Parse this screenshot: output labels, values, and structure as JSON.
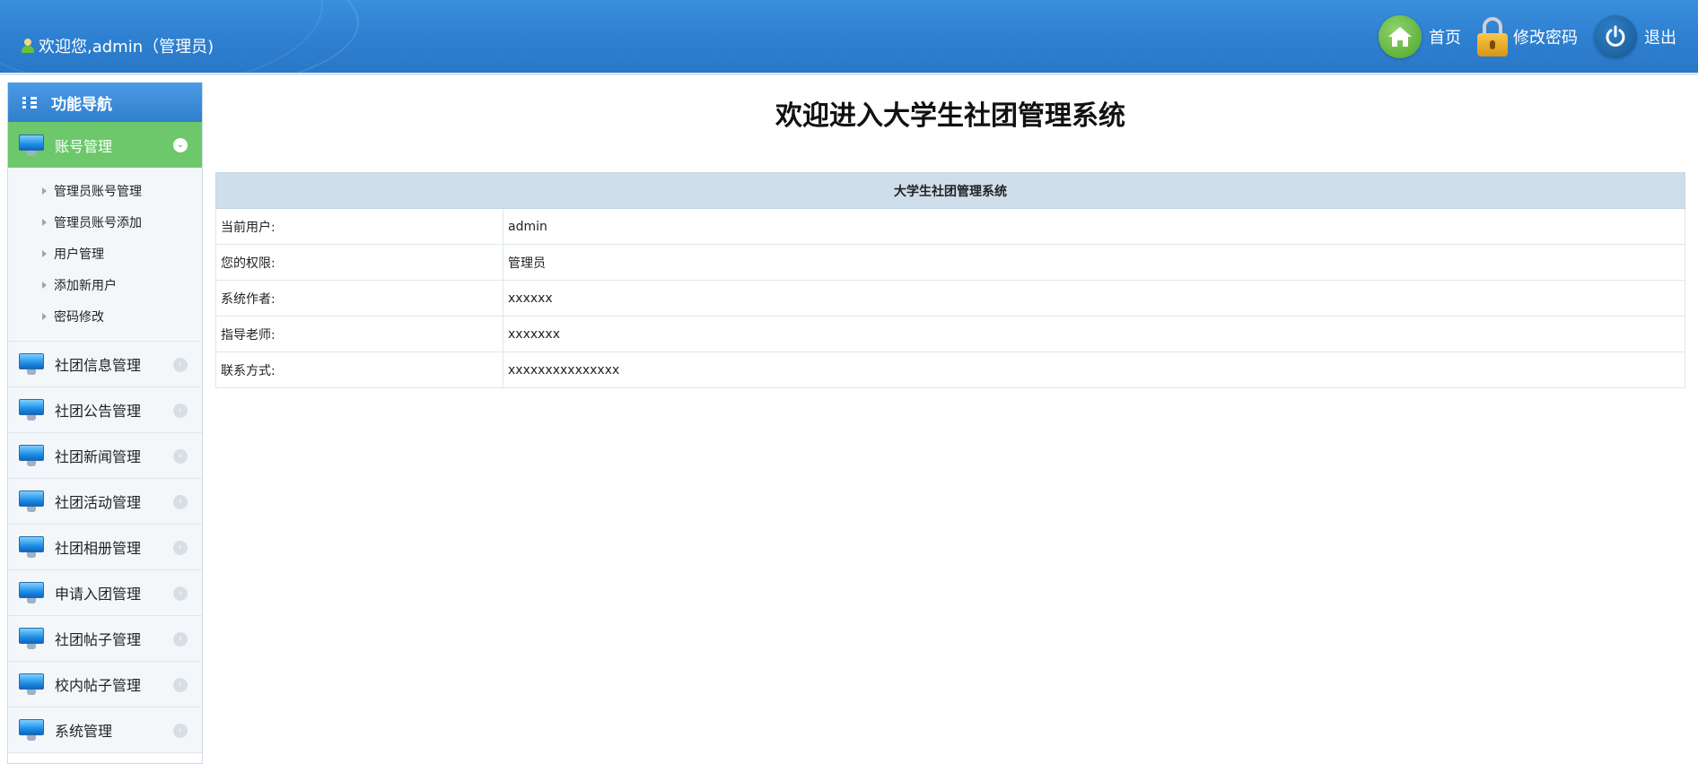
{
  "header": {
    "welcome": "欢迎您,admin（管理员)",
    "nav": {
      "home": "首页",
      "change_password": "修改密码",
      "logout": "退出"
    }
  },
  "sidebar": {
    "title": "功能导航",
    "active_group": "账号管理",
    "sub_items": [
      "管理员账号管理",
      "管理员账号添加",
      "用户管理",
      "添加新用户",
      "密码修改"
    ],
    "groups": [
      "社团信息管理",
      "社团公告管理",
      "社团新闻管理",
      "社团活动管理",
      "社团相册管理",
      "申请入团管理",
      "社团帖子管理",
      "校内帖子管理",
      "系统管理"
    ]
  },
  "main": {
    "title": "欢迎进入大学生社团管理系统",
    "table": {
      "caption": "大学生社团管理系统",
      "rows": [
        {
          "label": "当前用户:",
          "value": "admin"
        },
        {
          "label": "您的权限:",
          "value": "管理员"
        },
        {
          "label": "系统作者:",
          "value": "xxxxxx"
        },
        {
          "label": "指导老师:",
          "value": "xxxxxxx"
        },
        {
          "label": "联系方式:",
          "value": "xxxxxxxxxxxxxxx"
        }
      ]
    }
  },
  "colors": {
    "header_blue": "#2d7fd0",
    "active_green": "#6cc86a",
    "table_header": "#cfdeeb"
  }
}
